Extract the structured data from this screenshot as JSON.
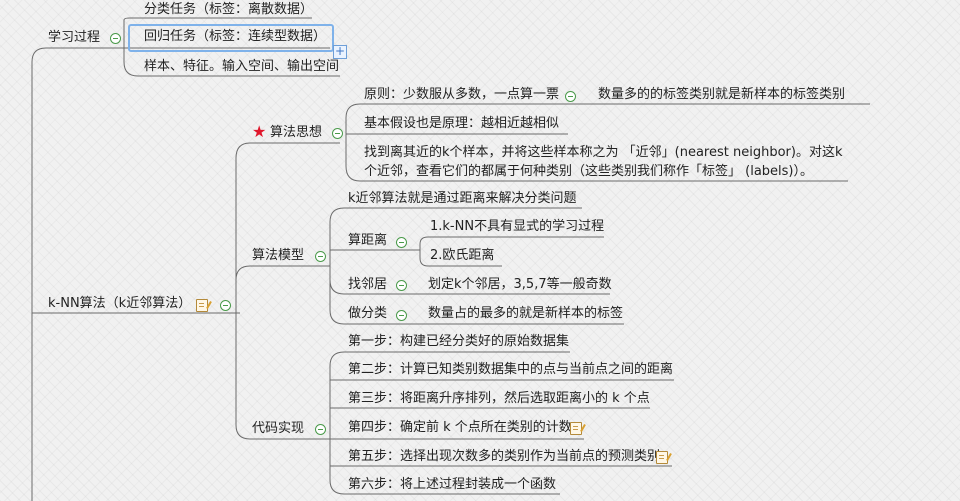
{
  "colors": {
    "line": "#6b6b6b",
    "toggle": "#4a9a4a",
    "star": "#e0162b",
    "selection": "#7fb2ea"
  },
  "root": {
    "label": "k-NN算法（k近邻算法）"
  },
  "study": {
    "label": "学习过程",
    "children": [
      "分类任务（标签：离散数据）",
      "回归任务（标签：连续型数据）",
      "样本、特征。输入空间、输出空间"
    ]
  },
  "idea": {
    "label": "算法思想",
    "icon": "star-icon",
    "principle": "原则：少数服从多数，一点算一票",
    "principle_detail": "数量多的的标签类别就是新样本的标签类别",
    "assumption": "基本假设也是原理：越相近越相似",
    "neighbors": "找到离其近的k个样本，并将这些样本称之为 「近邻」(nearest neighbor)。对这k个近邻，查看它们的都属于何种类别（这些类别我们称作「标签」 (labels)）。"
  },
  "model": {
    "label": "算法模型",
    "intro": "k近邻算法就是通过距离来解决分类问题",
    "distance": {
      "label": "算距离",
      "items": [
        "1.k-NN不具有显式的学习过程",
        "2.欧氏距离"
      ]
    },
    "find": {
      "label": "找邻居",
      "detail": "划定k个邻居，3,5,7等一般奇数"
    },
    "classify": {
      "label": "做分类",
      "detail": "数量占的最多的就是新样本的标签"
    }
  },
  "code": {
    "label": "代码实现",
    "steps": [
      "第一步：构建已经分类好的原始数据集",
      "第二步：计算已知类别数据集中的点与当前点之间的距离",
      "第三步：将距离升序排列，然后选取距离小的 k 个点",
      "第四步：确定前 k 个点所在类别的计数",
      "第五步：选择出现次数多的类别作为当前点的预测类别",
      "第六步：将上述过程封装成一个函数"
    ]
  }
}
